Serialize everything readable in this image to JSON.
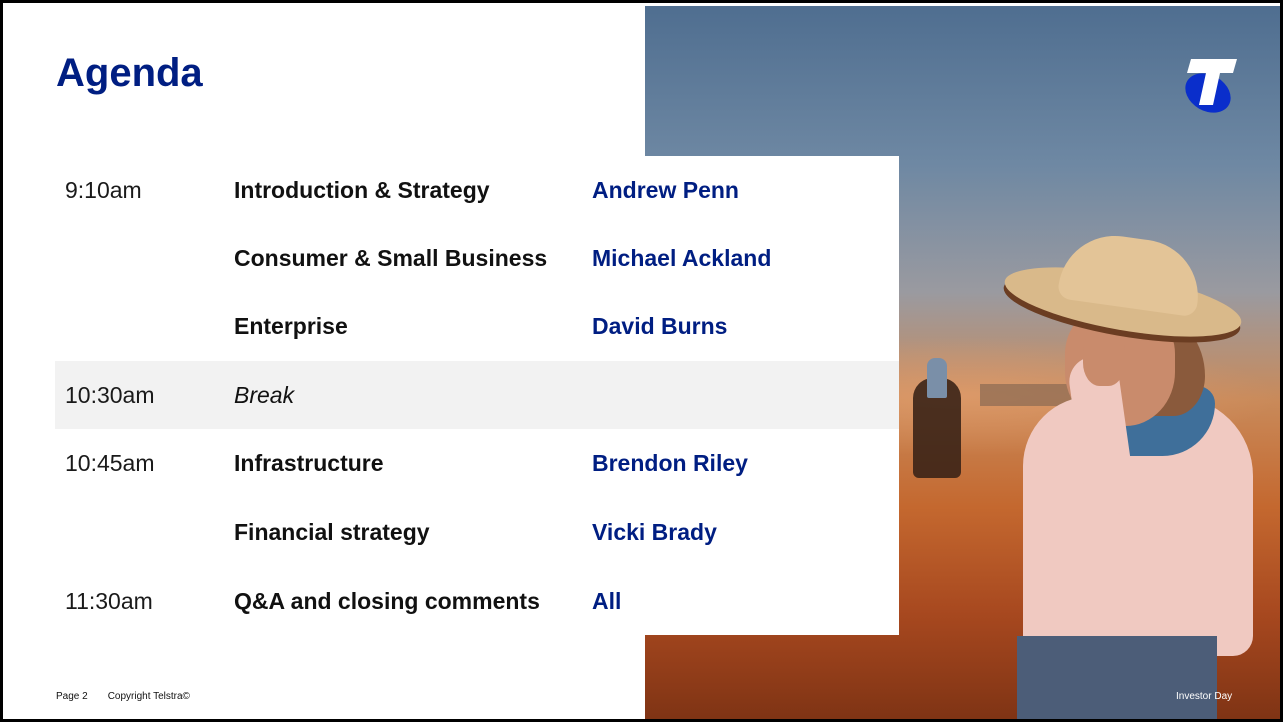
{
  "title": "Agenda",
  "agenda": [
    {
      "time": "9:10am",
      "topic": "Introduction & Strategy",
      "speaker": "Andrew Penn"
    },
    {
      "time": "",
      "topic": "Consumer & Small Business",
      "speaker": "Michael Ackland"
    },
    {
      "time": "",
      "topic": "Enterprise",
      "speaker": "David Burns"
    },
    {
      "time": "10:30am",
      "topic": "Break",
      "speaker": ""
    },
    {
      "time": "10:45am",
      "topic": "Infrastructure",
      "speaker": "Brendon Riley"
    },
    {
      "time": "",
      "topic": "Financial strategy",
      "speaker": "Vicki Brady"
    },
    {
      "time": "11:30am",
      "topic": "Q&A and closing comments",
      "speaker": "All"
    }
  ],
  "footer": {
    "page": "Page 2",
    "copyright": "Copyright Telstra©",
    "event": "Investor Day"
  },
  "colors": {
    "brand_blue": "#001e82",
    "break_row": "#f2f2f2"
  },
  "icons": {
    "logo": "telstra-logo-icon"
  }
}
